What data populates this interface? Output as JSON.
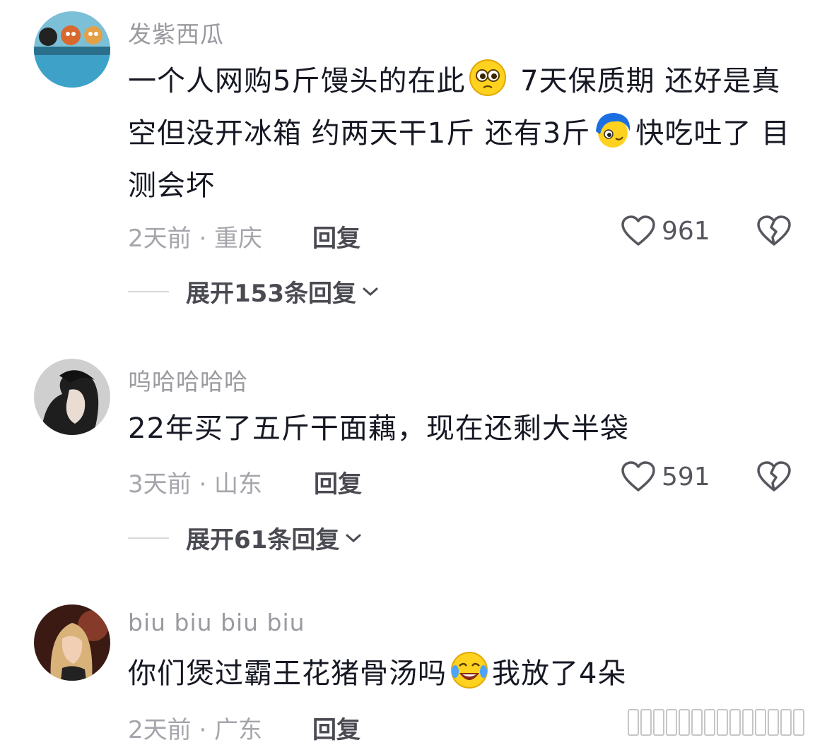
{
  "comments": [
    {
      "username": "发紫西瓜",
      "content_parts": [
        "一个人网购5斤馒头的在此",
        " 7天保质期 还好是真空但没开冰箱 约两天干1斤 还有3斤",
        "快吃吐了 目测会坏"
      ],
      "emojis": [
        "pleading-emoji",
        "blue-hair-emoji"
      ],
      "time_location": "2天前 · 重庆",
      "reply_label": "回复",
      "likes": "961",
      "expand_label": "展开153条回复"
    },
    {
      "username": "呜哈哈哈哈",
      "content_parts": [
        "22年买了五斤干面藕，现在还剩大半袋"
      ],
      "emojis": [],
      "time_location": "3天前 · 山东",
      "reply_label": "回复",
      "likes": "591",
      "expand_label": "展开61条回复"
    },
    {
      "username": "biu biu biu biu",
      "content_parts": [
        "你们煲过霸王花猪骨汤吗",
        "我放了4朵"
      ],
      "emojis": [
        "laugh-cry-emoji"
      ],
      "time_location": "2天前 · 广东",
      "reply_label": "回复"
    }
  ],
  "icons": {
    "like": "heart-outline-icon",
    "dislike": "broken-heart-icon",
    "expand": "chevron-down-icon"
  },
  "colors": {
    "text": "#161823",
    "muted": "#a5a5ab",
    "background": "#ffffff"
  }
}
